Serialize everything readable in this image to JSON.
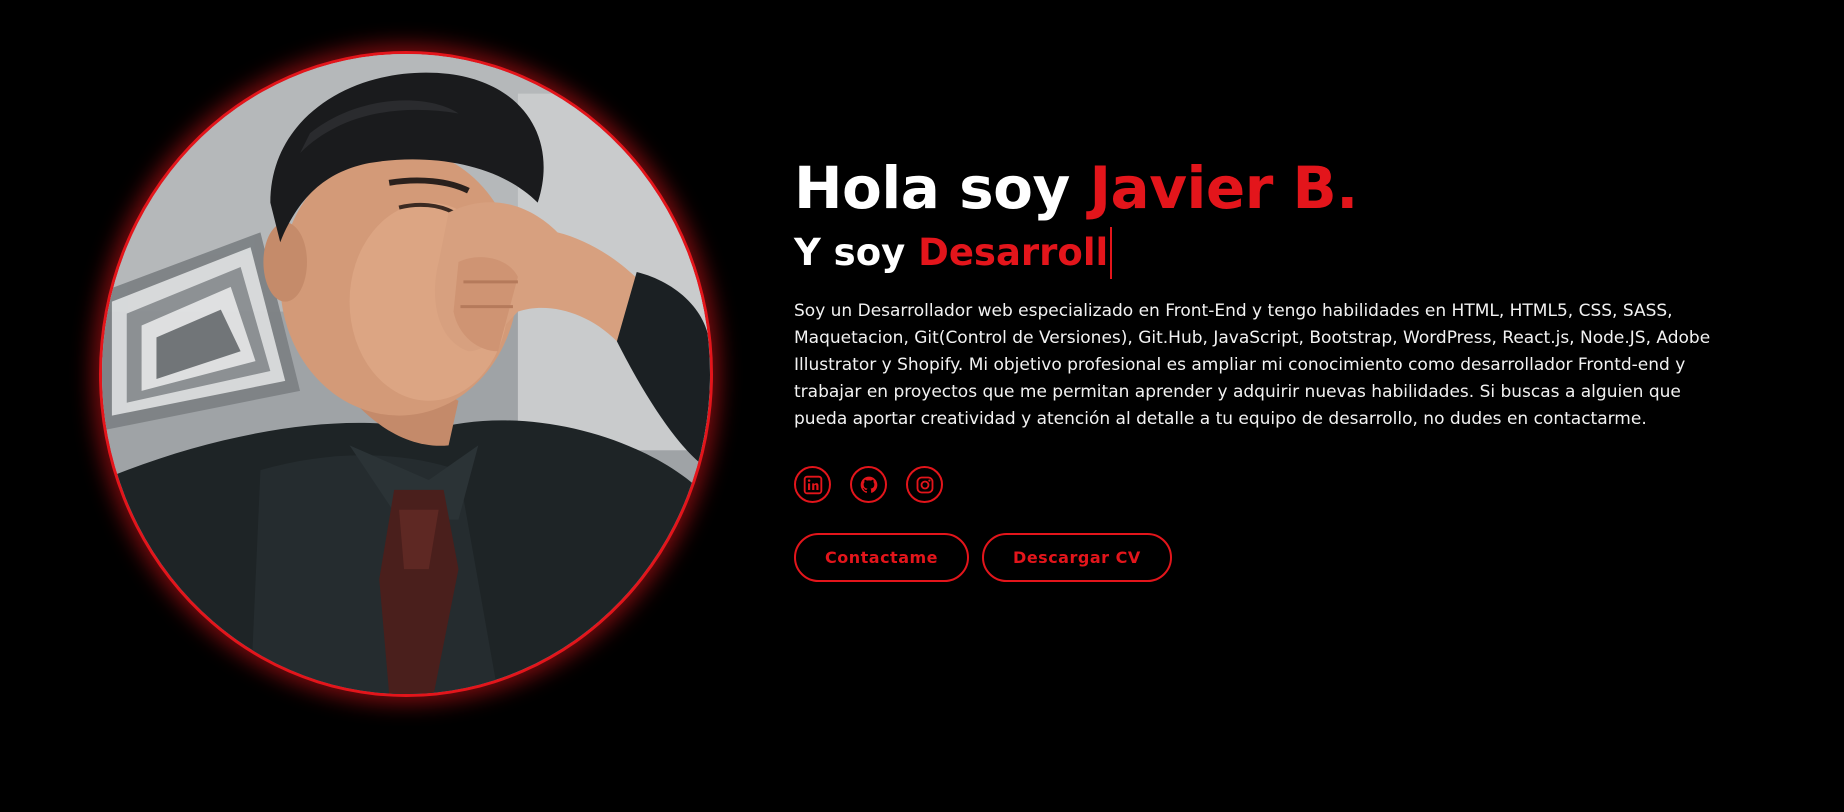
{
  "colors": {
    "background": "#000000",
    "accent": "#e3151b",
    "text": "#ffffff"
  },
  "hero": {
    "greeting_prefix": "Hola soy ",
    "name": "Javier B.",
    "subtitle_prefix": "Y soy ",
    "typed_role": "Desarroll",
    "bio": "Soy un Desarrollador web especializado en Front-End y tengo habilidades en HTML, HTML5, CSS, SASS, Maquetacion, Git(Control de Versiones), Git.Hub, JavaScript, Bootstrap, WordPress, React.js, Node.JS, Adobe Illustrator y Shopify. Mi objetivo profesional es ampliar mi conocimiento como desarrollador Frontd-end y trabajar en proyectos que me permitan aprender y adquirir nuevas habilidades. Si buscas a alguien que pueda aportar creatividad y atención al detalle a tu equipo de desarrollo, no dudes en contactarme."
  },
  "socials": [
    {
      "icon": "linkedin-icon"
    },
    {
      "icon": "github-icon"
    },
    {
      "icon": "instagram-icon"
    }
  ],
  "buttons": {
    "contact_label": "Contactame",
    "cv_label": "Descargar CV"
  }
}
